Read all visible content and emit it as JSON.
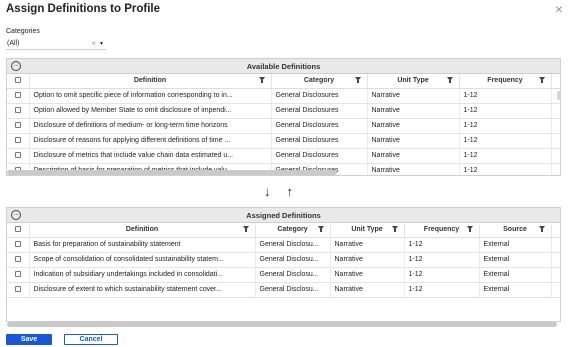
{
  "dialog": {
    "title": "Assign Definitions to Profile",
    "close_glyph": "×"
  },
  "categories": {
    "label": "Categories",
    "value": "(All)",
    "clear_glyph": "×",
    "caret_glyph": "▼"
  },
  "available": {
    "title": "Available Definitions",
    "menu_glyph": "···",
    "columns": [
      "Definition",
      "Category",
      "Unit Type",
      "Frequency"
    ],
    "rows": [
      [
        "Option to omit specific piece of information corresponding to in...",
        "General Disclosures",
        "Narrative",
        "1-12"
      ],
      [
        "Option allowed by Member State to omit disclosure of impendi...",
        "General Disclosures",
        "Narrative",
        "1-12"
      ],
      [
        "Disclosure of definitions of medium- or long-term time horizons",
        "General Disclosures",
        "Narrative",
        "1-12"
      ],
      [
        "Disclosure of reasons for applying different definitions of time ...",
        "General Disclosures",
        "Narrative",
        "1-12"
      ],
      [
        "Disclosure of metrics that include value chain data estimated u...",
        "General Disclosures",
        "Narrative",
        "1-12"
      ],
      [
        "Description of basis for preparation of metrics that include valu...",
        "General Disclosures",
        "Narrative",
        "1-12"
      ]
    ]
  },
  "transfer": {
    "down_glyph": "↓",
    "up_glyph": "↑"
  },
  "assigned": {
    "title": "Assigned Definitions",
    "menu_glyph": "···",
    "columns": [
      "Definition",
      "Category",
      "Unit Type",
      "Frequency",
      "Source"
    ],
    "rows": [
      [
        "Basis for preparation of sustainability statement",
        "General Disclosu...",
        "Narrative",
        "1-12",
        "External"
      ],
      [
        "Scope of consolidation of consolidated sustainability statem...",
        "General Disclosu...",
        "Narrative",
        "1-12",
        "External"
      ],
      [
        "Indication of subsidiary undertakings included in consolidati...",
        "General Disclosu...",
        "Narrative",
        "1-12",
        "External"
      ],
      [
        "Disclosure of extent to which sustainability statement cover...",
        "General Disclosu...",
        "Narrative",
        "1-12",
        "External"
      ]
    ]
  },
  "footer": {
    "save_label": "Save",
    "cancel_label": "Cancel"
  },
  "colors": {
    "primary": "#1a57d6",
    "header_bg": "#e9e9e9"
  }
}
